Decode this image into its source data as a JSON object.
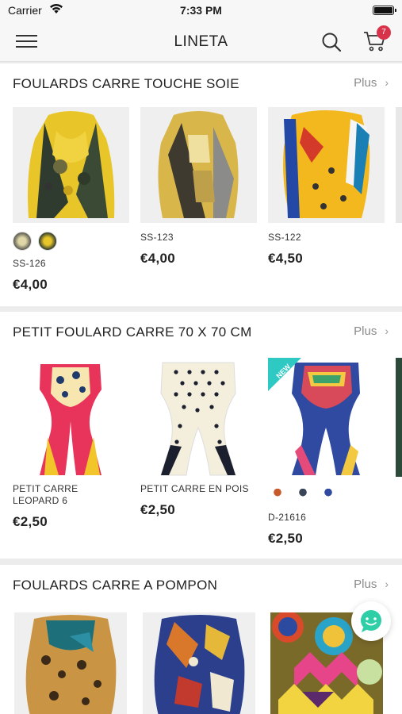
{
  "status_bar": {
    "carrier": "Carrier",
    "time": "7:33 PM"
  },
  "header": {
    "title": "LINETA",
    "cart_count": "7"
  },
  "sections": [
    {
      "title": "FOULARDS CARRE TOUCHE SOIE",
      "more_label": "Plus",
      "products": [
        {
          "sku": "SS-126",
          "price": "€4,00"
        },
        {
          "sku": "SS-123",
          "price": "€4,00"
        },
        {
          "sku": "SS-122",
          "price": "€4,50"
        }
      ]
    },
    {
      "title": "PETIT FOULARD CARRE 70 X 70 CM",
      "more_label": "Plus",
      "products": [
        {
          "sku": "PETIT CARRE LEOPARD 6",
          "price": "€2,50"
        },
        {
          "sku": "PETIT CARRE EN POIS",
          "price": "€2,50"
        },
        {
          "sku": "D-21616",
          "price": "€2,50",
          "badge": "NEW"
        }
      ]
    },
    {
      "title": "FOULARDS CARRE A POMPON",
      "more_label": "Plus",
      "products": []
    }
  ],
  "icons": {
    "menu": "hamburger-menu-icon",
    "search": "search-icon",
    "cart": "shopping-cart-icon",
    "chat": "chat-bubble-icon",
    "more": "chevron-right-icon"
  },
  "colors": {
    "badge": "#d8334a",
    "new_ribbon": "#2ec9c3",
    "chat_accent": "#2ecfa6"
  }
}
